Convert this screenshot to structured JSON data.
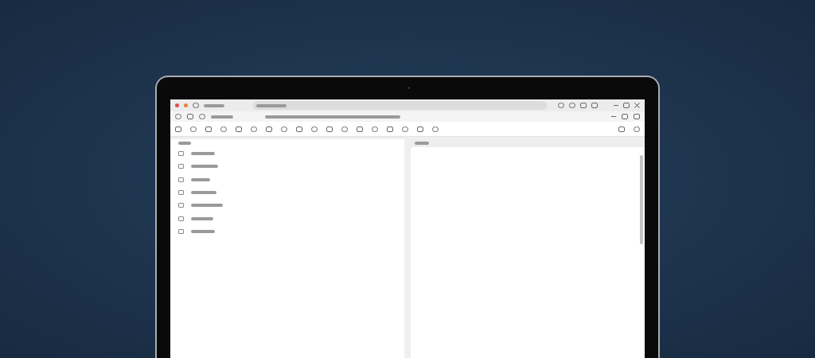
{
  "list": {
    "items": [
      {
        "checked": false
      },
      {
        "checked": false
      },
      {
        "checked": false
      },
      {
        "checked": false
      },
      {
        "checked": false
      },
      {
        "checked": false
      },
      {
        "checked": false
      }
    ]
  }
}
